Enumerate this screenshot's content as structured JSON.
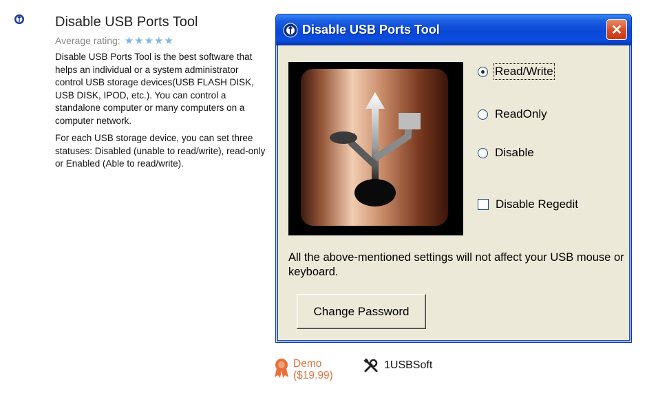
{
  "product": {
    "title": "Disable USB Ports Tool",
    "rating_label": "Average rating:",
    "rating_stars": "★★★★★",
    "description": [
      "Disable USB Ports Tool is the best software that helps an individual or a system administrator control USB storage devices(USB FLASH DISK, USB DISK, IPOD, etc.). You can control a standalone computer or many computers on a computer network.",
      "For each USB storage device, you can set three statuses: Disabled (unable to read/write), read-only or Enabled (Able to read/write)."
    ]
  },
  "dialog": {
    "title": "Disable USB Ports Tool",
    "options": {
      "read_write": "Read/Write",
      "read_only": "ReadOnly",
      "disable": "Disable"
    },
    "selected_option": "read_write",
    "disable_regedit_label": "Disable Regedit",
    "disable_regedit_checked": false,
    "note": "All the above-mentioned settings will not affect your USB mouse or keyboard.",
    "change_password_label": "Change Password"
  },
  "footer": {
    "demo_label": "Demo",
    "price": "($19.99)",
    "vendor": "1USBSoft"
  },
  "colors": {
    "xp_title_blue": "#0a48d6",
    "demo_orange": "#e2703a",
    "star_blue": "#7fb7e6"
  }
}
